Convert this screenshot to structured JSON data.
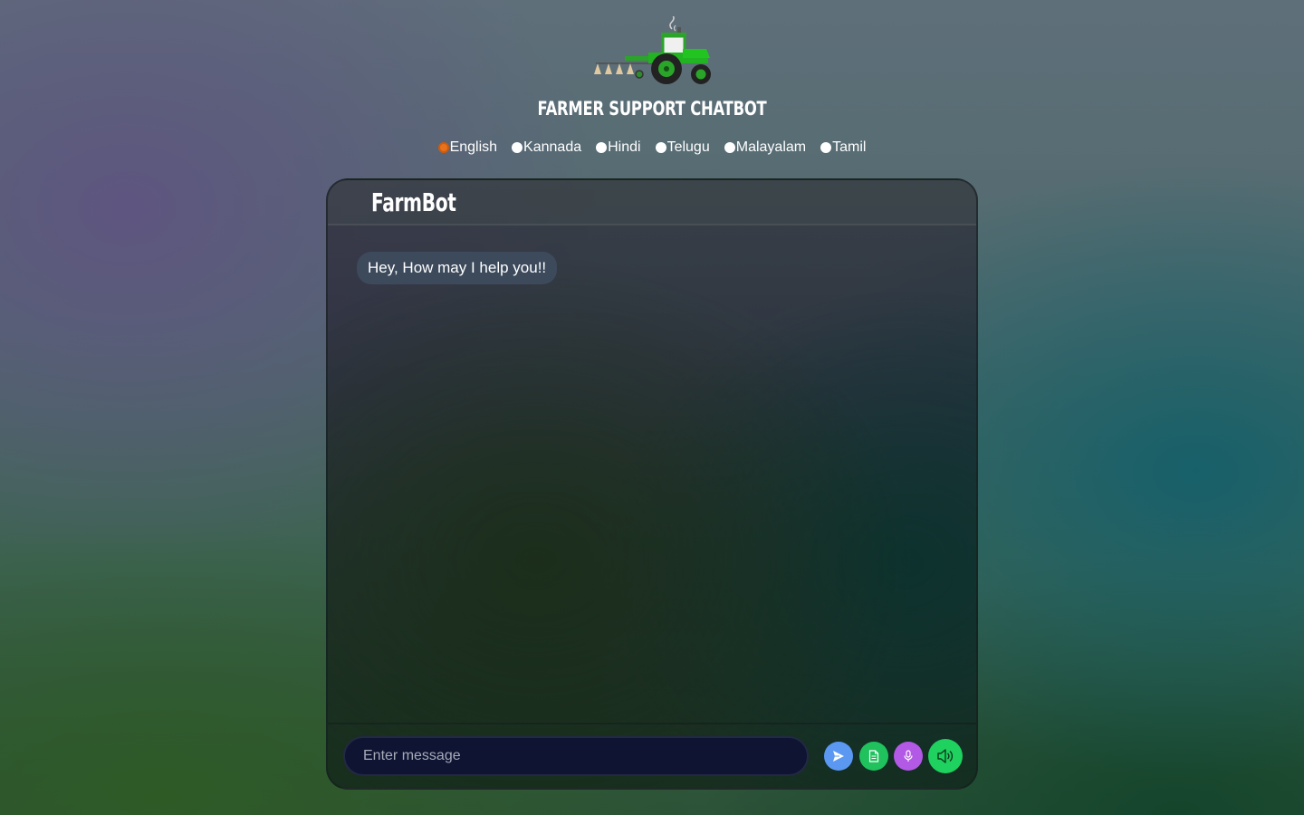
{
  "header": {
    "title": "FARMER SUPPORT CHATBOT",
    "logo_icon": "tractor-icon"
  },
  "languages": {
    "selected": "English",
    "options": [
      "English",
      "Kannada",
      "Hindi",
      "Telugu",
      "Malayalam",
      "Tamil"
    ]
  },
  "chat": {
    "bot_name": "FarmBot",
    "messages": [
      {
        "sender": "bot",
        "text": "Hey, How may I help you!!"
      }
    ],
    "input": {
      "value": "",
      "placeholder": "Enter message"
    },
    "buttons": {
      "send_icon": "send-icon",
      "file_icon": "file-icon",
      "mic_icon": "microphone-icon",
      "speaker_icon": "speaker-icon"
    }
  },
  "colors": {
    "send": "#5a98f2",
    "file": "#20c25e",
    "mic": "#b259e6",
    "speaker": "#1fd15f",
    "radio_selected": "#e8731c",
    "bubble": "#3c4a5c",
    "input_bg": "#0f1433"
  }
}
